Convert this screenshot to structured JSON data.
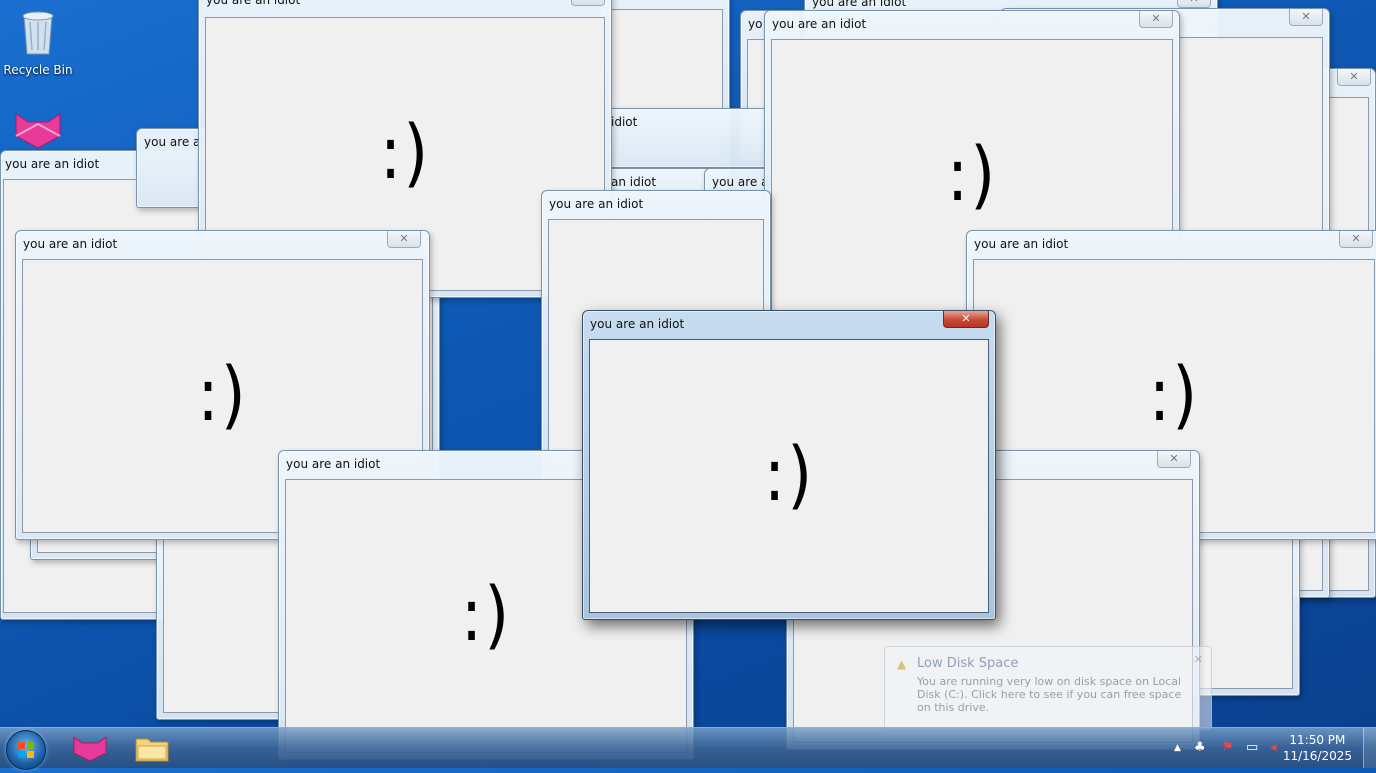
{
  "desktop": {
    "recycle_bin_label": "Recycle Bin"
  },
  "window": {
    "title": "you are an idiot",
    "content": ":)",
    "close_glyph": "✕"
  },
  "partial_titles": {
    "t1": "you are an idiot",
    "t2": "you are an idiot",
    "t3": "idiot",
    "t4": "an idiot",
    "t5": "you are an",
    "t6": "you are an idiot"
  },
  "notification": {
    "title": "Low Disk Space",
    "body": "You are running very low on disk space on Local Disk (C:). Click here to see if you can free space on this drive.",
    "icon": "warning-icon"
  },
  "taskbar": {
    "time": "11:50 PM",
    "date": "11/16/2025"
  },
  "colors": {
    "desktop": "#0f5bb8",
    "close_active": "#c74a36"
  }
}
